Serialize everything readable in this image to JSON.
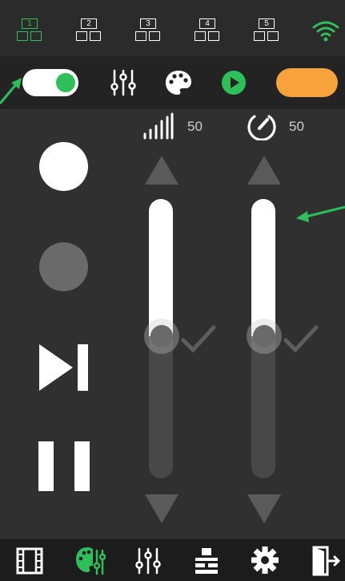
{
  "colors": {
    "accent": "#2fbf5a",
    "orange": "#f7a23a",
    "bg": "#303030"
  },
  "presets": [
    {
      "num": "1",
      "active": true
    },
    {
      "num": "2",
      "active": false
    },
    {
      "num": "3",
      "active": false
    },
    {
      "num": "4",
      "active": false
    },
    {
      "num": "5",
      "active": false
    }
  ],
  "toolbar": {
    "toggle_on": true,
    "icons": [
      "mixer-icon",
      "palette-icon",
      "play-circle-icon"
    ]
  },
  "sliders": [
    {
      "name": "signal",
      "icon": "signal-bars-icon",
      "value_label": "50",
      "level": 0.5
    },
    {
      "name": "speed",
      "icon": "speedometer-icon",
      "value_label": "50",
      "level": 0.5
    }
  ],
  "bottom_nav": [
    "film-icon",
    "palette-icon",
    "mixer-icon",
    "hierarchy-icon",
    "gear-icon",
    "exit-icon"
  ]
}
